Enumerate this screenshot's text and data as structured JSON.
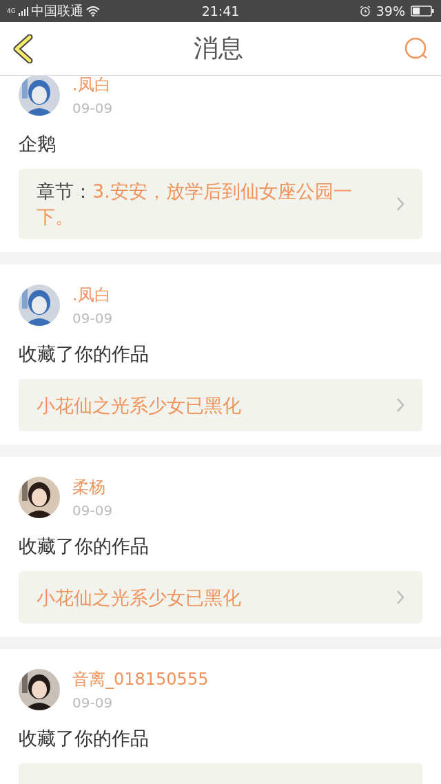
{
  "status_bar": {
    "network": "4G",
    "carrier": "中国联通",
    "time": "21:41",
    "battery": "39%"
  },
  "header": {
    "title": "消息"
  },
  "messages": [
    {
      "user": ".凤白",
      "date": "09-09",
      "text": "企鹅",
      "target": {
        "label": "章节：",
        "title": "3.安安，放学后到仙女座公园一下。"
      }
    },
    {
      "user": ".凤白",
      "date": "09-09",
      "text": "收藏了你的作品",
      "target": {
        "title": "小花仙之光系少女已黑化"
      }
    },
    {
      "user": "柔杨",
      "date": "09-09",
      "text": "收藏了你的作品",
      "target": {
        "title": "小花仙之光系少女已黑化"
      }
    },
    {
      "user": "音离_018150555",
      "date": "09-09",
      "text": "收藏了你的作品"
    }
  ]
}
